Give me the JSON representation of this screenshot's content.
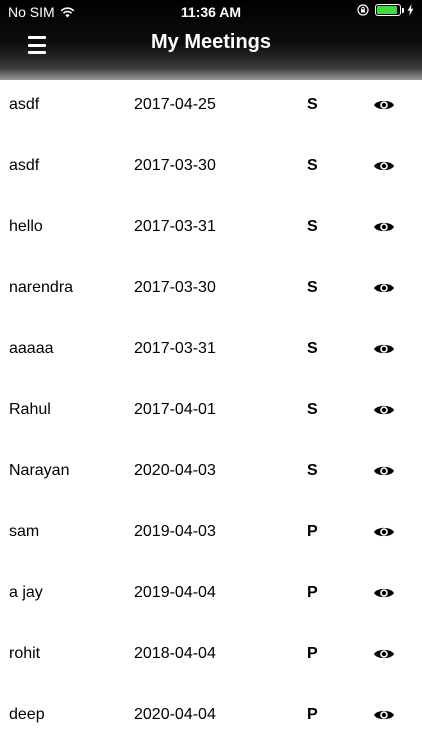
{
  "status_bar": {
    "carrier": "No SIM",
    "time": "11:36 AM",
    "battery_level": 0.9,
    "icons": [
      "wifi-icon",
      "orientation-lock-icon",
      "battery-icon",
      "charging-icon"
    ]
  },
  "header": {
    "title": "My Meetings",
    "menu_icon": "hamburger-menu-icon"
  },
  "meetings": [
    {
      "name": "asdf",
      "date": "2017-04-25",
      "type": "S"
    },
    {
      "name": "asdf",
      "date": "2017-03-30",
      "type": "S"
    },
    {
      "name": "hello",
      "date": "2017-03-31",
      "type": "S"
    },
    {
      "name": "narendra",
      "date": "2017-03-30",
      "type": "S"
    },
    {
      "name": "aaaaa",
      "date": "2017-03-31",
      "type": "S"
    },
    {
      "name": "Rahul",
      "date": "2017-04-01",
      "type": "S"
    },
    {
      "name": "Narayan",
      "date": "2020-04-03",
      "type": "S"
    },
    {
      "name": "sam",
      "date": "2019-04-03",
      "type": "P"
    },
    {
      "name": "a jay",
      "date": "2019-04-04",
      "type": "P"
    },
    {
      "name": "rohit",
      "date": "2018-04-04",
      "type": "P"
    },
    {
      "name": "deep",
      "date": "2020-04-04",
      "type": "P"
    }
  ],
  "colors": {
    "header_bg": "#000000",
    "header_text": "#ffffff",
    "row_text": "#000000",
    "battery": "#3ddc3d"
  }
}
